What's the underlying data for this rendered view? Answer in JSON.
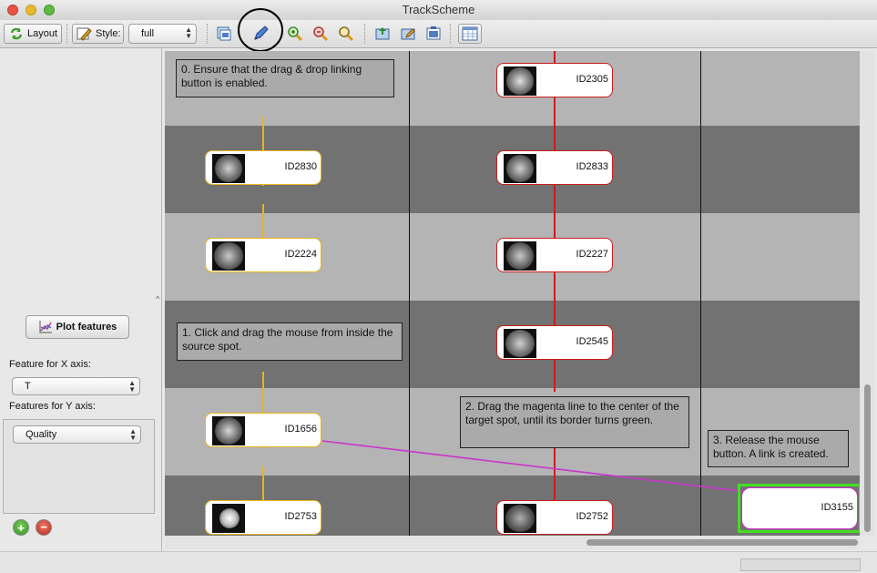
{
  "window": {
    "title": "TrackScheme"
  },
  "toolbar": {
    "layout_label": "Layout",
    "style_label": "Style:",
    "style_value": "full"
  },
  "sidebar": {
    "plot_features_label": "Plot features",
    "x_axis_label": "Feature for X axis:",
    "x_axis_value": "T",
    "y_axis_label": "Features for Y axis:",
    "y_axis_value": "Quality",
    "add_label": "+",
    "remove_label": "−"
  },
  "notes": {
    "step0": "0. Ensure that the drag & drop linking button is enabled.",
    "step1": "1. Click and drag the mouse from inside the source spot.",
    "step2": "2. Drag the magenta line to the center of the target spot, until its border turns green.",
    "step3": "3. Release the mouse button. A link is created."
  },
  "spots": {
    "left": [
      "ID2830",
      "ID2224",
      "ID1656",
      "ID2753"
    ],
    "right": [
      "ID2305",
      "ID2833",
      "ID2227",
      "ID2545",
      "ID2752"
    ],
    "target": "ID3155"
  },
  "colors": {
    "track_yellow": "#e8b51c",
    "track_red": "#cc1c1c",
    "drag_line": "#cc33cc",
    "target_border": "#44dd22",
    "band_dark": "#727272",
    "band_light": "#b4b4b4"
  },
  "icons": {
    "layout": "refresh-arrows-icon",
    "style": "paint-icon",
    "linking": "pen-link-icon",
    "zoom_in": "zoom-in-icon",
    "zoom_out": "zoom-out-icon",
    "zoom_fit": "zoom-fit-icon"
  }
}
